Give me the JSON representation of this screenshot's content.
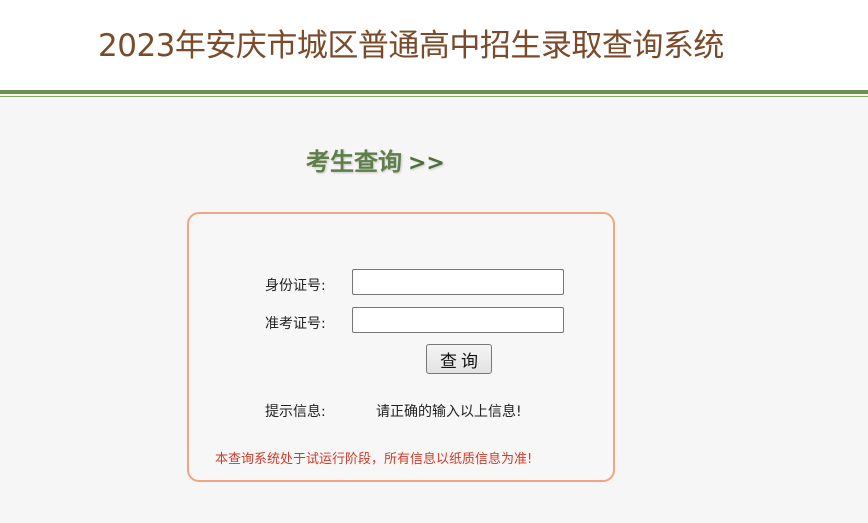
{
  "header": {
    "title": "2023年安庆市城区普通高中招生录取查询系统"
  },
  "section": {
    "title": "考生查询",
    "arrows": ">>"
  },
  "form": {
    "id_label": "身份证号:",
    "id_value": "",
    "exam_label": "准考证号:",
    "exam_value": "",
    "submit_label": "查询",
    "hint_label": "提示信息:",
    "hint_value": "请正确的输入以上信息!",
    "notice": "本查询系统处于试运行阶段，所有信息以纸质信息为准!"
  },
  "colors": {
    "title": "#7a4a2a",
    "accent": "#6f8f4e",
    "panel_border": "#f0a67e",
    "notice": "#d23a2a"
  }
}
